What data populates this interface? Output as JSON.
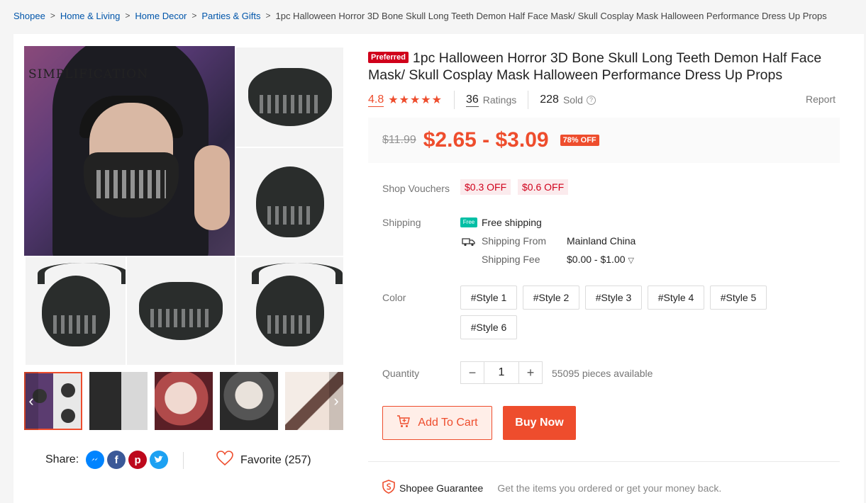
{
  "breadcrumb": {
    "items": [
      "Shopee",
      "Home & Living",
      "Home Decor",
      "Parties & Gifts"
    ],
    "current": "1pc Halloween Horror 3D Bone Skull Long Teeth Demon Half Face Mask/ Skull Cosplay Mask Halloween Performance Dress Up Props"
  },
  "gallery": {
    "watermark": "SIMPLIFICATION",
    "prev_icon": "chevron-left-icon",
    "next_icon": "chevron-right-icon"
  },
  "share": {
    "label": "Share:",
    "icons": [
      "messenger-icon",
      "facebook-icon",
      "pinterest-icon",
      "twitter-icon"
    ]
  },
  "favorite": {
    "label": "Favorite (257)"
  },
  "product": {
    "badge": "Preferred",
    "title": "1pc Halloween Horror 3D Bone Skull Long Teeth Demon Half Face Mask/ Skull Cosplay Mask Halloween Performance Dress Up Props",
    "rating": "4.8",
    "stars": "★★★★★",
    "ratings_count": "36",
    "ratings_label": "Ratings",
    "sold_count": "228",
    "sold_label": "Sold",
    "report": "Report"
  },
  "price": {
    "original": "$11.99",
    "current": "$2.65 - $3.09",
    "discount": "78% OFF"
  },
  "vouchers": {
    "label": "Shop Vouchers",
    "items": [
      "$0.3 OFF",
      "$0.6 OFF"
    ]
  },
  "shipping": {
    "label": "Shipping",
    "free_icon_text": "Free",
    "free": "Free shipping",
    "from_label": "Shipping From",
    "from_value": "Mainland China",
    "fee_label": "Shipping Fee",
    "fee_value": "$0.00 - $1.00"
  },
  "color": {
    "label": "Color",
    "options": [
      "#Style 1",
      "#Style 2",
      "#Style 3",
      "#Style 4",
      "#Style 5",
      "#Style 6"
    ]
  },
  "quantity": {
    "label": "Quantity",
    "value": "1",
    "available": "55095 pieces available"
  },
  "actions": {
    "add_to_cart": "Add To Cart",
    "buy_now": "Buy Now"
  },
  "guarantee": {
    "title": "Shopee Guarantee",
    "text": "Get the items you ordered or get your money back."
  },
  "colors": {
    "accent": "#ee4d2d",
    "link": "#0055aa"
  }
}
